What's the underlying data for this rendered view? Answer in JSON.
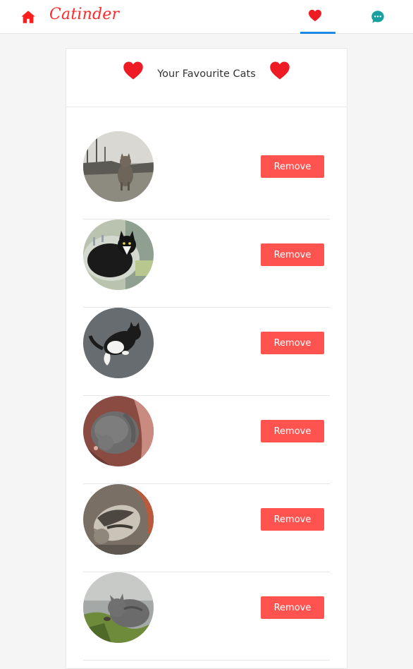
{
  "app": {
    "title": "Catinder"
  },
  "nav": {
    "home_icon": "home-icon",
    "favourites_icon": "heart-icon",
    "favourites_active": true,
    "messages_icon": "chat-bubble-icon"
  },
  "colors": {
    "brand_red": "#ff2a2a",
    "heart_red": "#ee1b24",
    "remove_button": "#ff5350",
    "active_tab_underline": "#1e88e5"
  },
  "favourites": {
    "title": "Your Favourite Cats",
    "remove_label": "Remove",
    "cats": [
      {
        "remove_label": "Remove"
      },
      {
        "remove_label": "Remove"
      },
      {
        "remove_label": "Remove"
      },
      {
        "remove_label": "Remove"
      },
      {
        "remove_label": "Remove"
      },
      {
        "remove_label": "Remove"
      }
    ]
  }
}
